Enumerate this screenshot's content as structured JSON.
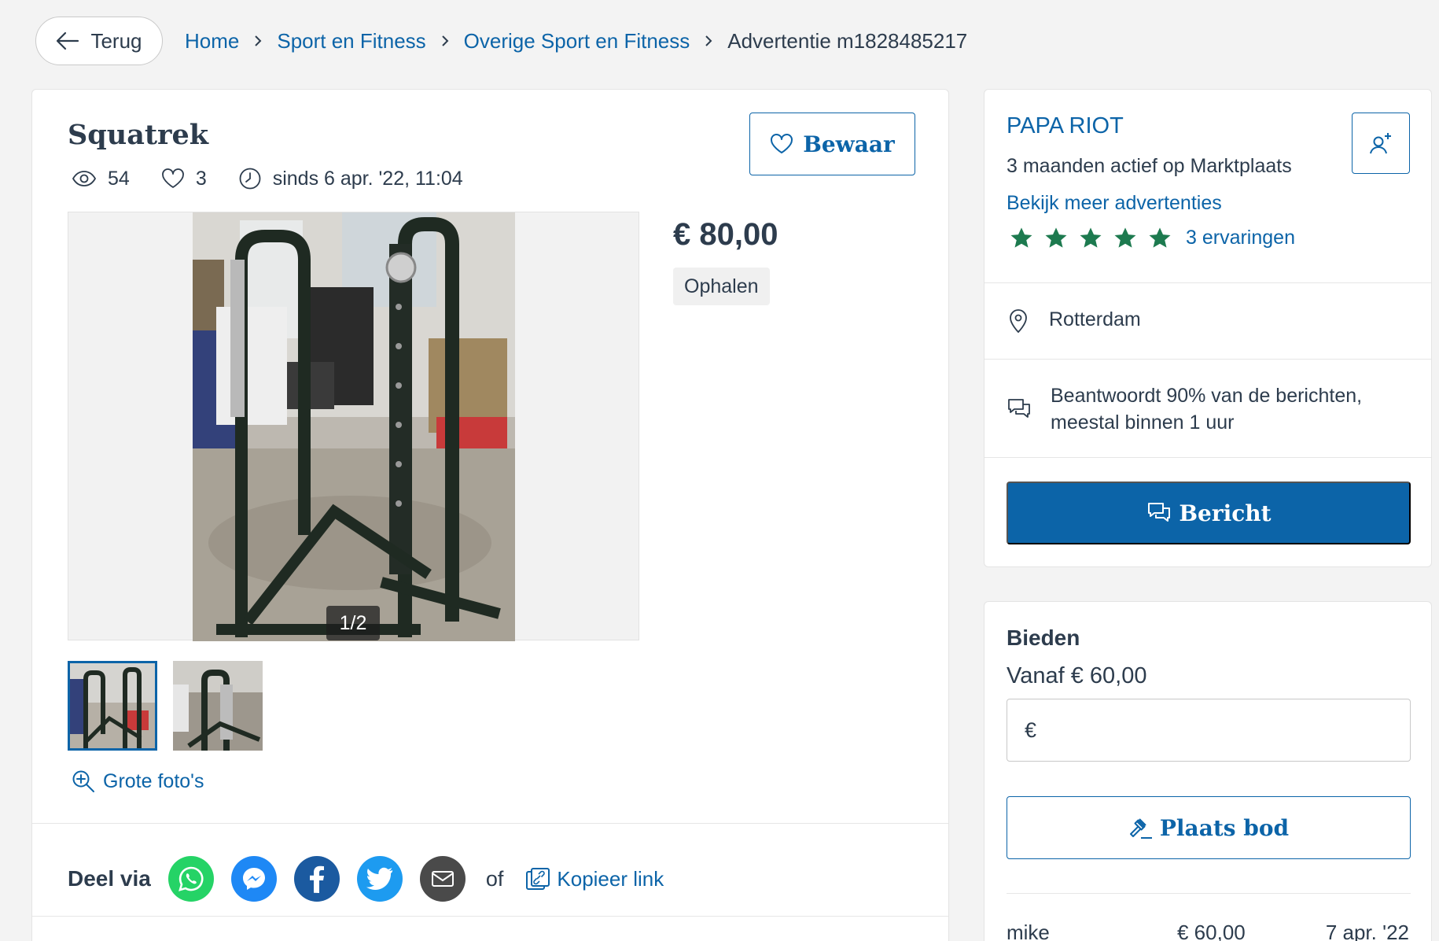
{
  "nav": {
    "back_label": "Terug",
    "breadcrumb": [
      "Home",
      "Sport en Fitness",
      "Overige Sport en Fitness"
    ],
    "breadcrumb_current": "Advertentie m1828485217"
  },
  "listing": {
    "title": "Squatrek",
    "views": "54",
    "favorites": "3",
    "since": "sinds 6 apr. '22, 11:04",
    "save_label": "Bewaar",
    "price": "€ 80,00",
    "delivery": "Ophalen",
    "photo_counter": "1/2",
    "big_photos_label": "Grote foto's"
  },
  "share": {
    "label": "Deel via",
    "or": "of",
    "copy_label": "Kopieer link",
    "icons": [
      "whatsapp-icon",
      "messenger-icon",
      "facebook-icon",
      "twitter-icon",
      "email-icon"
    ]
  },
  "seller": {
    "name": "PAPA RIOT",
    "active": "3 maanden actief op Marktplaats",
    "more_ads": "Bekijk meer advertenties",
    "stars": 5,
    "reviews": "3 ervaringen",
    "location": "Rotterdam",
    "response_line1": "Beantwoordt 90% van de berichten,",
    "response_line2": "meestal binnen 1 uur",
    "message_label": "Bericht"
  },
  "bid": {
    "title": "Bieden",
    "from": "Vanaf € 60,00",
    "currency": "€",
    "input_value": "",
    "place_label": "Plaats bod",
    "bids": [
      {
        "name": "mike",
        "amount": "€ 60,00",
        "date": "7 apr. '22"
      }
    ]
  },
  "colors": {
    "brand_blue": "#0c64a8",
    "text": "#2d3c4d",
    "star_green": "#1d7a4f",
    "whatsapp": "#25d366",
    "messenger": "#1e88f5",
    "facebook": "#1b5aa0",
    "twitter": "#1d9bf0",
    "email": "#4a4a4a"
  }
}
